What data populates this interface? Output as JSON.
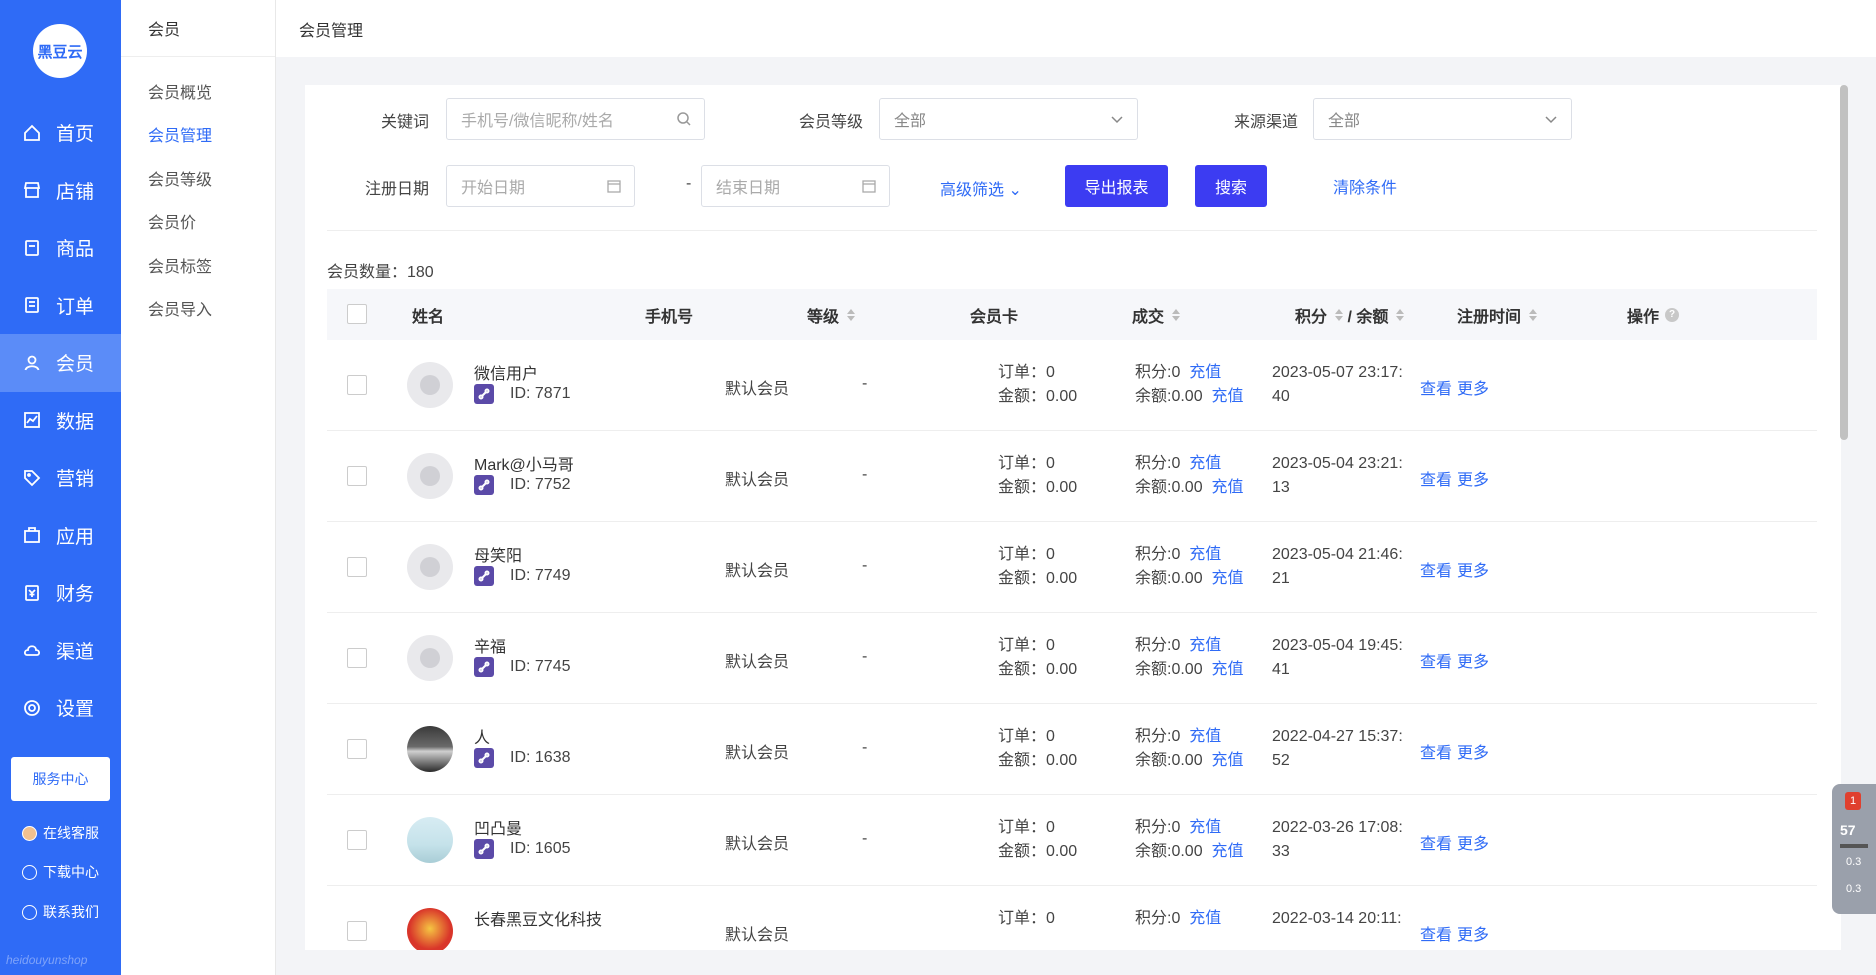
{
  "app": {
    "logo_text": "黑豆云",
    "footer_brand": "heidouyunshop"
  },
  "mainnav": {
    "items": [
      {
        "label": "首页",
        "icon": "home-icon",
        "active": false
      },
      {
        "label": "店铺",
        "icon": "store-icon",
        "active": false
      },
      {
        "label": "商品",
        "icon": "goods-icon",
        "active": false
      },
      {
        "label": "订单",
        "icon": "order-icon",
        "active": false
      },
      {
        "label": "会员",
        "icon": "user-icon",
        "active": true
      },
      {
        "label": "数据",
        "icon": "chart-icon",
        "active": false
      },
      {
        "label": "营销",
        "icon": "tag-icon",
        "active": false
      },
      {
        "label": "应用",
        "icon": "app-icon",
        "active": false
      },
      {
        "label": "财务",
        "icon": "finance-icon",
        "active": false
      },
      {
        "label": "渠道",
        "icon": "channel-icon",
        "active": false
      },
      {
        "label": "设置",
        "icon": "settings-icon",
        "active": false
      }
    ],
    "service_center": "服务中心",
    "online_service": "在线客服",
    "download_center": "下载中心",
    "contact_us": "联系我们"
  },
  "secnav": {
    "title": "会员",
    "items": [
      "会员概览",
      "会员管理",
      "会员等级",
      "会员价",
      "会员标签",
      "会员导入"
    ],
    "active_index": 1
  },
  "header": {
    "title": "会员管理"
  },
  "filters": {
    "keyword_label": "关键词",
    "keyword_placeholder": "手机号/微信昵称/姓名",
    "level_label": "会员等级",
    "level_value": "全部",
    "source_label": "来源渠道",
    "source_value": "全部",
    "date_label": "注册日期",
    "start_placeholder": "开始日期",
    "date_sep": "-",
    "end_placeholder": "结束日期",
    "advanced": "高级筛选",
    "export": "导出报表",
    "search": "搜索",
    "clear": "清除条件"
  },
  "summary": {
    "count_label": "会员数量：180"
  },
  "table": {
    "columns": {
      "name": "姓名",
      "phone": "手机号",
      "level": "等级",
      "card": "会员卡",
      "deal": "成交",
      "points": "积分",
      "balance_sep": "/ 余额",
      "reg_time": "注册时间",
      "ops": "操作"
    },
    "rows": [
      {
        "name": "微信用户",
        "id": "ID: 7871",
        "level": "默认会员",
        "card": "-",
        "orders": "订单：0",
        "amount": "金额：0.00",
        "points": "积分:0",
        "balance": "余额:0.00",
        "recharge": "充值",
        "reg1": "2023-05-07 23:17:",
        "reg2": "40",
        "view": "查看",
        "more": "更多",
        "avatar": "default"
      },
      {
        "name": "Mark@小马哥",
        "id": "ID: 7752",
        "level": "默认会员",
        "card": "-",
        "orders": "订单：0",
        "amount": "金额：0.00",
        "points": "积分:0",
        "balance": "余额:0.00",
        "recharge": "充值",
        "reg1": "2023-05-04 23:21:",
        "reg2": "13",
        "view": "查看",
        "more": "更多",
        "avatar": "default"
      },
      {
        "name": "母笑阳",
        "id": "ID: 7749",
        "level": "默认会员",
        "card": "-",
        "orders": "订单：0",
        "amount": "金额：0.00",
        "points": "积分:0",
        "balance": "余额:0.00",
        "recharge": "充值",
        "reg1": "2023-05-04 21:46:",
        "reg2": "21",
        "view": "查看",
        "more": "更多",
        "avatar": "default"
      },
      {
        "name": "辛福",
        "id": "ID: 7745",
        "level": "默认会员",
        "card": "-",
        "orders": "订单：0",
        "amount": "金额：0.00",
        "points": "积分:0",
        "balance": "余额:0.00",
        "recharge": "充值",
        "reg1": "2023-05-04 19:45:",
        "reg2": "41",
        "view": "查看",
        "more": "更多",
        "avatar": "default"
      },
      {
        "name": "人",
        "id": "ID: 1638",
        "level": "默认会员",
        "card": "-",
        "orders": "订单：0",
        "amount": "金额：0.00",
        "points": "积分:0",
        "balance": "余额:0.00",
        "recharge": "充值",
        "reg1": "2022-04-27 15:37:",
        "reg2": "52",
        "view": "查看",
        "more": "更多",
        "avatar": "photo-car"
      },
      {
        "name": "凹凸曼",
        "id": "ID: 1605",
        "level": "默认会员",
        "card": "-",
        "orders": "订单：0",
        "amount": "金额：0.00",
        "points": "积分:0",
        "balance": "余额:0.00",
        "recharge": "充值",
        "reg1": "2022-03-26 17:08:",
        "reg2": "33",
        "view": "查看",
        "more": "更多",
        "avatar": "photo-landscape"
      },
      {
        "name": "长春黑豆文化科技",
        "id": "",
        "level": "默认会员",
        "card": "",
        "orders": "订单：0",
        "amount": "",
        "points": "积分:0",
        "balance": "",
        "recharge": "充值",
        "reg1": "2022-03-14 20:11:",
        "reg2": "",
        "view": "查看",
        "more": "更多",
        "avatar": "photo-red"
      }
    ]
  },
  "widget": {
    "badge": "1",
    "percent": "57",
    "up": "0.3",
    "down": "0.3"
  },
  "colors": {
    "primary": "#2f6bf6",
    "button": "#3c3cf2"
  }
}
